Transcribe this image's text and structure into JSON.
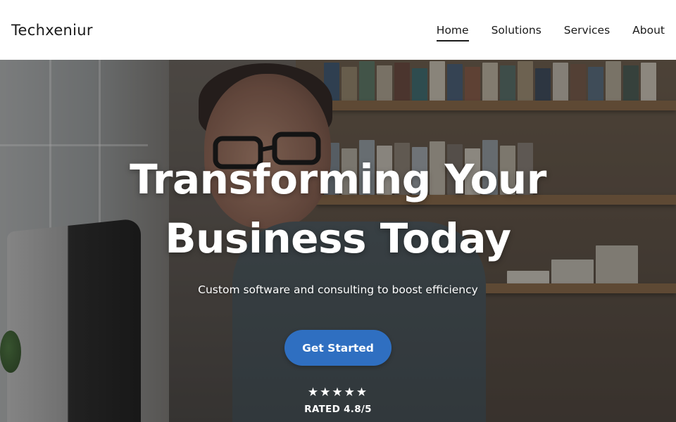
{
  "header": {
    "logo": "Techxeniur",
    "nav": [
      {
        "label": "Home",
        "active": true
      },
      {
        "label": "Solutions",
        "active": false
      },
      {
        "label": "Services",
        "active": false
      },
      {
        "label": "About",
        "active": false
      }
    ]
  },
  "hero": {
    "title_line1": "Transforming Your",
    "title_line2": "Business Today",
    "subtitle": "Custom software and consulting to boost efficiency",
    "cta_label": "Get Started",
    "cta_color": "#2f6fc1",
    "rating": {
      "stars": [
        "★",
        "★",
        "★",
        "★",
        "★"
      ],
      "text": "RATED 4.8/5"
    }
  }
}
